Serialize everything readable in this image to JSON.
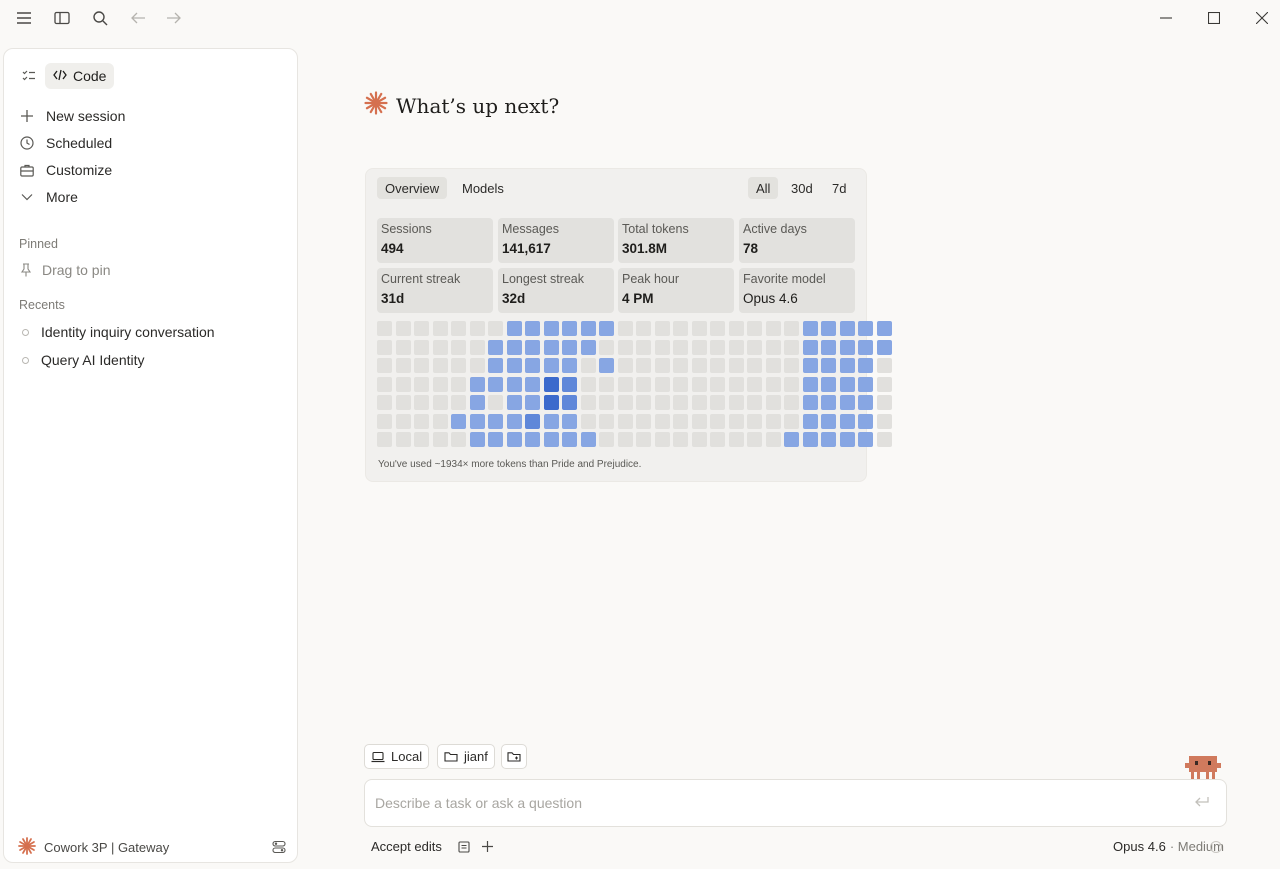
{
  "sidebar": {
    "mode_label": "Code",
    "nav": [
      {
        "label": "New session",
        "icon": "plus-icon"
      },
      {
        "label": "Scheduled",
        "icon": "clock-icon"
      },
      {
        "label": "Customize",
        "icon": "briefcase-icon"
      },
      {
        "label": "More",
        "icon": "chevron-down-icon"
      }
    ],
    "pinned_label": "Pinned",
    "pin_hint": "Drag to pin",
    "recents_label": "Recents",
    "recents": [
      "Identity inquiry conversation",
      "Query AI Identity"
    ],
    "footer_label": "Cowork 3P | Gateway"
  },
  "main": {
    "greeting": "What’s up next?",
    "stats_card": {
      "tabs": [
        "Overview",
        "Models"
      ],
      "active_tab": "Overview",
      "ranges": [
        "All",
        "30d",
        "7d"
      ],
      "active_range": "All",
      "stats": [
        {
          "label": "Sessions",
          "value": "494"
        },
        {
          "label": "Messages",
          "value": "141,617"
        },
        {
          "label": "Total tokens",
          "value": "301.8M"
        },
        {
          "label": "Active days",
          "value": "78"
        },
        {
          "label": "Current streak",
          "value": "31d"
        },
        {
          "label": "Longest streak",
          "value": "32d"
        },
        {
          "label": "Peak hour",
          "value": "4 PM"
        },
        {
          "label": "Favorite model",
          "value": "Opus 4.6"
        }
      ],
      "heatmap_levels": [
        "0000000111111000000000011111",
        "0000001111110000000000011111",
        "0000001111101000000000011110",
        "0000011113200000000000011110",
        "0000010113200000000000011110",
        "0000111121100000000000011110",
        "0000011111110000000000111110"
      ],
      "heat_colors": [
        "#e1e0dd",
        "#87a6e3",
        "#5f87d9",
        "#3c6acc"
      ],
      "note": "You've used ~1934× more tokens than Pride and Prejudice."
    },
    "chips": {
      "env": "Local",
      "folder": "jianf"
    },
    "input_placeholder": "Describe a task or ask a question",
    "accept_edits": "Accept edits",
    "model": "Opus 4.6",
    "effort": "· Medium"
  }
}
